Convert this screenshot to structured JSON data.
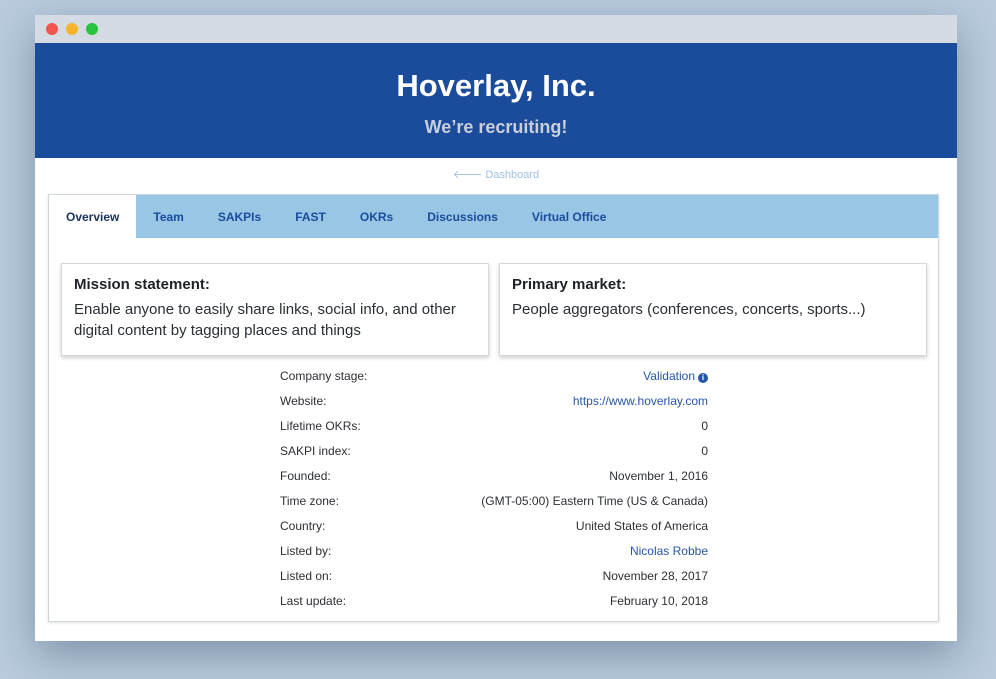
{
  "hero": {
    "title": "Hoverlay, Inc.",
    "subtitle": "We’re recruiting!"
  },
  "breadcrumb": {
    "arrow": "🡐",
    "label": "Dashboard"
  },
  "tabs": [
    {
      "label": "Overview"
    },
    {
      "label": "Team"
    },
    {
      "label": "SAKPIs"
    },
    {
      "label": "FAST"
    },
    {
      "label": "OKRs"
    },
    {
      "label": "Discussions"
    },
    {
      "label": "Virtual Office"
    }
  ],
  "cards": {
    "mission": {
      "title": "Mission statement:",
      "text": "Enable anyone to easily share links, social info, and other digital content by tagging places and things"
    },
    "market": {
      "title": "Primary market:",
      "text": "People aggregators (conferences, concerts, sports...)"
    }
  },
  "details": [
    {
      "label": "Company stage:",
      "value": "Validation"
    },
    {
      "label": "Website:",
      "value": "https://www.hoverlay.com"
    },
    {
      "label": "Lifetime OKRs:",
      "value": "0"
    },
    {
      "label": "SAKPI index:",
      "value": "0"
    },
    {
      "label": "Founded:",
      "value": "November 1, 2016"
    },
    {
      "label": "Time zone:",
      "value": "(GMT-05:00) Eastern Time (US & Canada)"
    },
    {
      "label": "Country:",
      "value": "United States of America"
    },
    {
      "label": "Listed by:",
      "value": "Nicolas Robbe"
    },
    {
      "label": "Listed on:",
      "value": "November 28, 2017"
    },
    {
      "label": "Last update:",
      "value": "February 10, 2018"
    }
  ],
  "info_icon": "i",
  "colors": {
    "hero_bg": "#1b4b9b",
    "tabs_bg": "#9ac6e6",
    "link": "#2557a7"
  }
}
